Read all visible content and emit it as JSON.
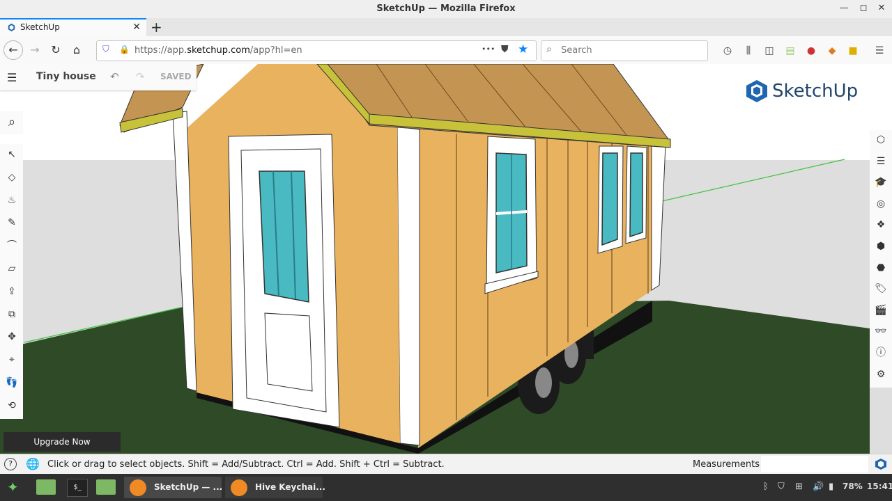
{
  "window": {
    "title": "SketchUp — Mozilla Firefox",
    "minimize": "—",
    "maximize": "◻",
    "close": "✕"
  },
  "tab": {
    "label": "SketchUp",
    "close": "✕",
    "newtab": "+"
  },
  "nav": {
    "back": "←",
    "forward": "→",
    "reload": "↻",
    "home": "⌂",
    "url_prefix": "https://app.",
    "url_host": "sketchup.com",
    "url_path": "/app?hl=en",
    "more": "•••",
    "search_placeholder": "Search"
  },
  "app": {
    "menu_icon": "☰",
    "model_name": "Tiny house",
    "undo": "↶",
    "redo": "↷",
    "saved": "SAVED",
    "logo_text": "SketchUp",
    "upgrade": "Upgrade Now"
  },
  "left_tools": [
    {
      "name": "select-tool",
      "glyph": "↖"
    },
    {
      "name": "eraser-tool",
      "glyph": "◇"
    },
    {
      "name": "paint-bucket-tool",
      "glyph": "♨"
    },
    {
      "name": "pencil-tool",
      "glyph": "✎"
    },
    {
      "name": "arc-tool",
      "glyph": "⌒"
    },
    {
      "name": "rectangle-tool",
      "glyph": "▱"
    },
    {
      "name": "push-pull-tool",
      "glyph": "⇪"
    },
    {
      "name": "offset-tool",
      "glyph": "⧉"
    },
    {
      "name": "move-tool",
      "glyph": "✥"
    },
    {
      "name": "tape-measure-tool",
      "glyph": "⌖"
    },
    {
      "name": "walk-tool",
      "glyph": "👣"
    },
    {
      "name": "orbit-tool",
      "glyph": "⟲"
    }
  ],
  "right_tools": [
    {
      "name": "entity-info-icon",
      "glyph": "⬡"
    },
    {
      "name": "outliner-icon",
      "glyph": "☰"
    },
    {
      "name": "instructor-icon",
      "glyph": "🎓"
    },
    {
      "name": "materials-icon",
      "glyph": "◎"
    },
    {
      "name": "components-icon",
      "glyph": "❖"
    },
    {
      "name": "3d-warehouse-icon",
      "glyph": "⬢"
    },
    {
      "name": "styles-icon",
      "glyph": "⬣"
    },
    {
      "name": "tags-icon",
      "glyph": "🏷"
    },
    {
      "name": "scenes-icon",
      "glyph": "🎬"
    },
    {
      "name": "display-icon",
      "glyph": "👓"
    },
    {
      "name": "info-icon",
      "glyph": "ⓘ"
    },
    {
      "name": "solid-inspector-icon",
      "glyph": "⚙"
    }
  ],
  "status": {
    "help": "?",
    "message": "Click or drag to select objects. Shift = Add/Subtract. Ctrl = Add. Shift + Ctrl = Subtract.",
    "measurements_label": "Measurements",
    "measurements_value": ""
  },
  "taskbar": {
    "tasks": [
      "SketchUp — ...",
      "Hive Keychai..."
    ],
    "battery": "78%",
    "time": "15:41"
  },
  "colors": {
    "accent": "#0a84ff",
    "wall": "#e9b25e",
    "trim": "#ffffff",
    "roof": "#c49552",
    "grass": "#2f4a27",
    "sky": "#ffffff",
    "ground_wall": "#dedede",
    "glass": "#49b9c2",
    "sketchup_blue": "#20466b"
  }
}
